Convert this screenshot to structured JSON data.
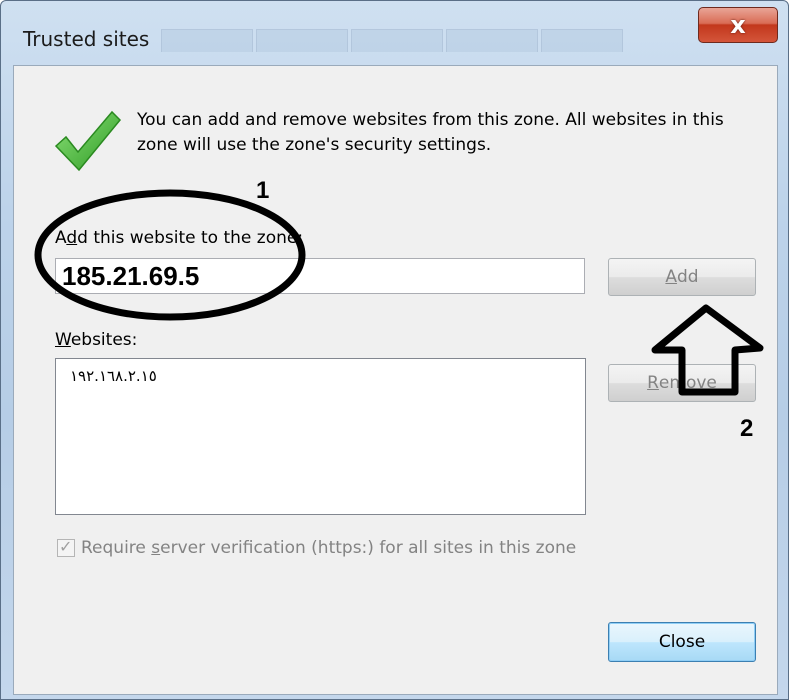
{
  "window": {
    "title": "Trusted sites",
    "close_glyph": "x"
  },
  "info": {
    "icon": "green-checkmark-icon",
    "text": "You can add and remove websites from this zone. All websites in this zone will use the zone's security settings."
  },
  "add_site": {
    "label_prefix": "A",
    "label_accel": "d",
    "label_rest": "d this website to the zone:",
    "value": "185.21.69.5",
    "button_prefix": "",
    "button_accel": "A",
    "button_rest": "dd"
  },
  "websites": {
    "label_accel": "W",
    "label_rest": "ebsites:",
    "items": [
      "١٩٢.١٦٨.٢.١٥"
    ],
    "remove_accel": "R",
    "remove_rest": "emove"
  },
  "verification": {
    "checked": true,
    "text_prefix": "Require ",
    "text_accel": "s",
    "text_rest": "erver verification (https:) for all sites in this zone"
  },
  "footer": {
    "close_label": "Close"
  },
  "annotations": {
    "step1": "1",
    "step2": "2",
    "ink_color": "#000000"
  },
  "colors": {
    "disabled_text": "#838383",
    "check_green": "#3aa82e"
  }
}
